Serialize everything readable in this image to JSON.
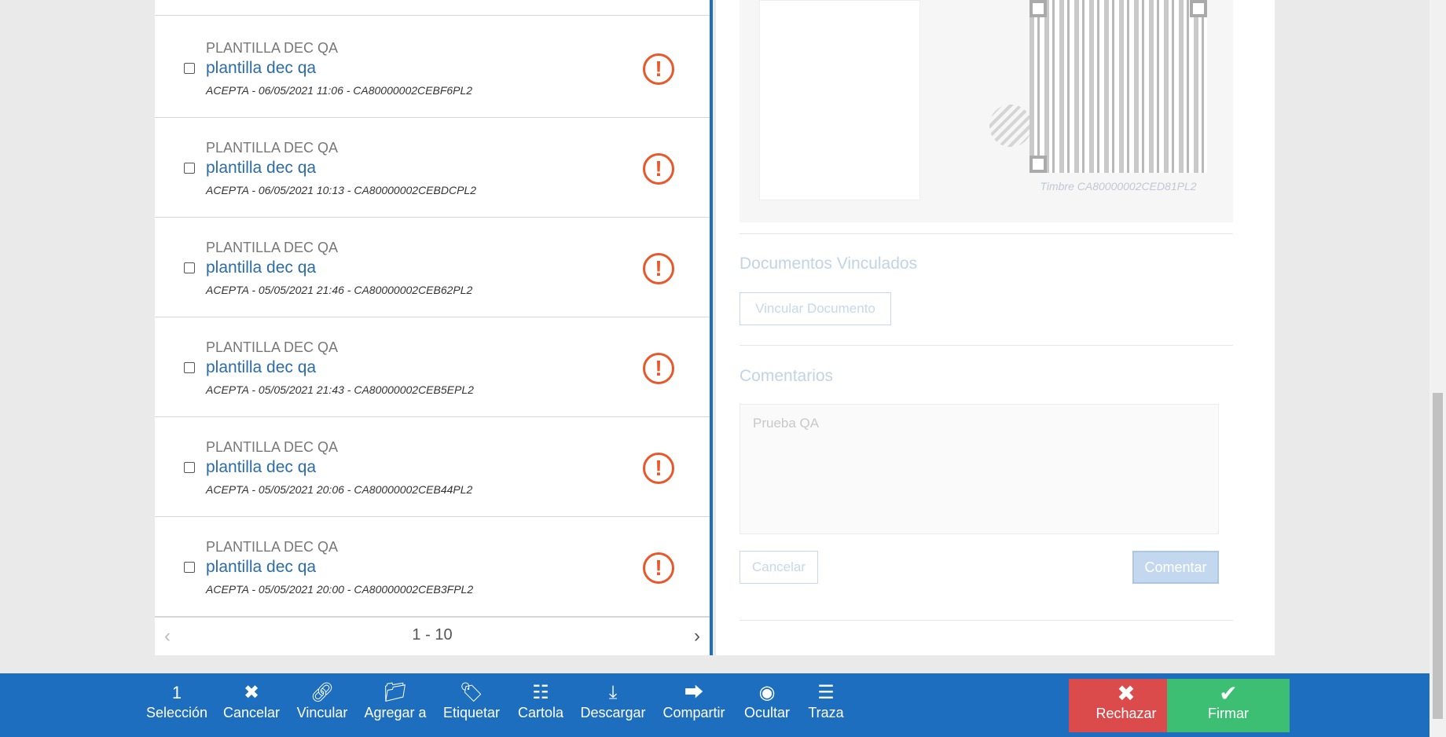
{
  "list": {
    "items": [
      {
        "title": "PLANTILLA DEC QA",
        "name": "plantilla dec qa",
        "meta": "ACEPTA - 06/05/2021 11:06 - CA80000002CEBF6PL2"
      },
      {
        "title": "PLANTILLA DEC QA",
        "name": "plantilla dec qa",
        "meta": "ACEPTA - 06/05/2021 10:13 - CA80000002CEBDCPL2"
      },
      {
        "title": "PLANTILLA DEC QA",
        "name": "plantilla dec qa",
        "meta": "ACEPTA - 05/05/2021 21:46 - CA80000002CEB62PL2"
      },
      {
        "title": "PLANTILLA DEC QA",
        "name": "plantilla dec qa",
        "meta": "ACEPTA - 05/05/2021 21:43 - CA80000002CEB5EPL2"
      },
      {
        "title": "PLANTILLA DEC QA",
        "name": "plantilla dec qa",
        "meta": "ACEPTA - 05/05/2021 20:06 - CA80000002CEB44PL2"
      },
      {
        "title": "PLANTILLA DEC QA",
        "name": "plantilla dec qa",
        "meta": "ACEPTA - 05/05/2021 20:00 - CA80000002CEB3FPL2"
      }
    ],
    "warning_icon": "exclamation-circle-icon",
    "warning_color": "#e8582a",
    "pager": {
      "range": "1 - 10",
      "prev_icon": "chevron-left-icon",
      "next_icon": "chevron-right-icon"
    }
  },
  "detail": {
    "timbre": "Timbre CA80000002CED81PL2",
    "linked_docs": {
      "title": "Documentos Vinculados",
      "button": "Vincular Documento"
    },
    "comments": {
      "title": "Comentarios",
      "value": "Prueba QA",
      "cancel": "Cancelar",
      "submit": "Comentar"
    }
  },
  "toolbar": {
    "selection_count": "1",
    "selection_label": "Selección",
    "cancel": "Cancelar",
    "link": "Vincular",
    "add_to": "Agregar a",
    "tag": "Etiquetar",
    "cartola": "Cartola",
    "download": "Descargar",
    "share": "Compartir",
    "hide": "Ocultar",
    "trace": "Traza",
    "reject": "Rechazar",
    "sign": "Firmar"
  },
  "colors": {
    "accent": "#1e6ec0",
    "reject": "#dc4b4b",
    "sign": "#3cbf73",
    "link_text": "#2b6ca8"
  }
}
